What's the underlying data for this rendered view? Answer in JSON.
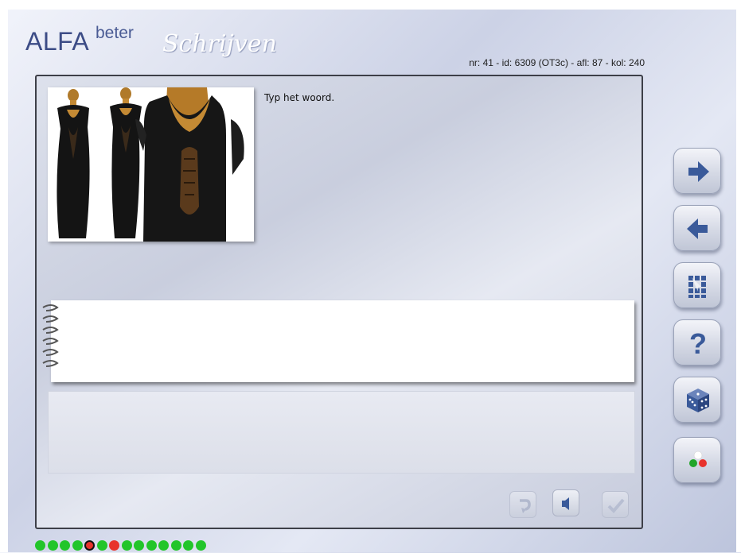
{
  "app": {
    "logo_main": "ALFA",
    "logo_super": "beter",
    "logo_script": "Schrijven"
  },
  "header": {
    "info": "nr: 41 - id: 6309 (OT3c) - afl: 87 - kol: 240"
  },
  "exercise": {
    "instruction": "Typ het woord.",
    "answer_value": "",
    "image_icon": "black-dresses-photo"
  },
  "side_buttons": [
    {
      "name": "next",
      "icon": "arrow-right-icon"
    },
    {
      "name": "previous",
      "icon": "arrow-left-icon"
    },
    {
      "name": "overview",
      "icon": "grid-icon"
    },
    {
      "name": "help",
      "icon": "question-icon"
    },
    {
      "name": "random",
      "icon": "dice-icon"
    },
    {
      "name": "progress",
      "icon": "traffic-dots-icon"
    }
  ],
  "bottom_buttons": [
    {
      "name": "retry",
      "icon": "undo-arrow-icon",
      "enabled": false
    },
    {
      "name": "audio",
      "icon": "speaker-icon",
      "enabled": true
    },
    {
      "name": "check",
      "icon": "checkmark-icon",
      "enabled": false
    }
  ],
  "progress_dots": [
    "green",
    "green",
    "green",
    "green",
    "current",
    "green",
    "red",
    "green",
    "green",
    "green",
    "green",
    "green",
    "green",
    "green"
  ],
  "colors": {
    "green": "#22c52a",
    "red": "#e8322c",
    "current": "#e8322c",
    "accent_blue": "#3a5a9a",
    "logo_blue": "#3c4c86"
  }
}
